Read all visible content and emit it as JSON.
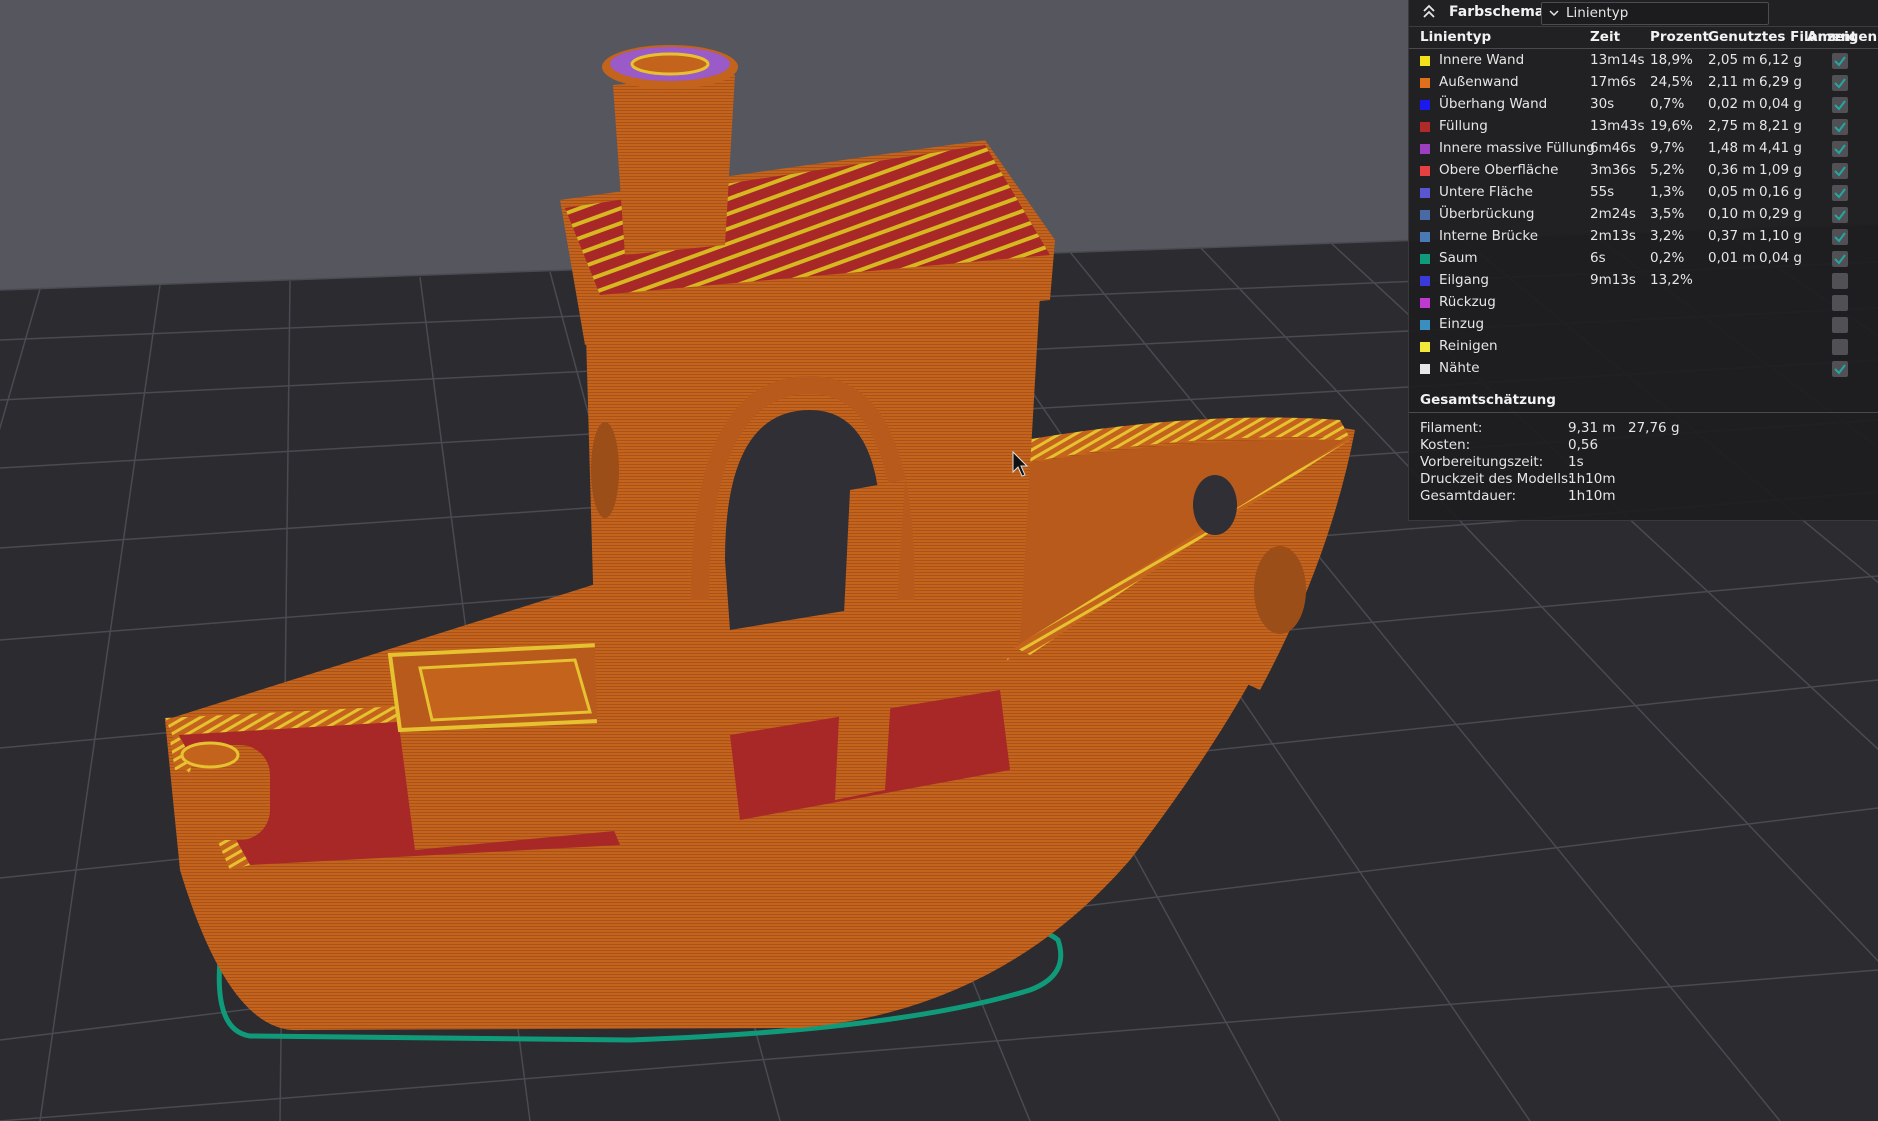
{
  "panel": {
    "title": "Farbschema",
    "scheme_value": "Linientyp",
    "columns": {
      "type": "Linientyp",
      "time": "Zeit",
      "percent": "Prozent",
      "used_filament": "Genutztes Filament",
      "show": "Anzeigen"
    },
    "rows": [
      {
        "name": "Innere Wand",
        "color": "#f2e21a",
        "time": "13m14s",
        "percent": "18,9%",
        "length": "2,05 m",
        "weight": "6,12 g",
        "shown": true
      },
      {
        "name": "Außenwand",
        "color": "#e0701c",
        "time": "17m6s",
        "percent": "24,5%",
        "length": "2,11 m",
        "weight": "6,29 g",
        "shown": true
      },
      {
        "name": "Überhang Wand",
        "color": "#1a1aee",
        "time": "30s",
        "percent": "0,7%",
        "length": "0,02 m",
        "weight": "0,04 g",
        "shown": true
      },
      {
        "name": "Füllung",
        "color": "#b02a2a",
        "time": "13m43s",
        "percent": "19,6%",
        "length": "2,75 m",
        "weight": "8,21 g",
        "shown": true
      },
      {
        "name": "Innere massive Füllung",
        "color": "#9a3fc0",
        "time": "6m46s",
        "percent": "9,7%",
        "length": "1,48 m",
        "weight": "4,41 g",
        "shown": true
      },
      {
        "name": "Obere Oberfläche",
        "color": "#e64040",
        "time": "3m36s",
        "percent": "5,2%",
        "length": "0,36 m",
        "weight": "1,09 g",
        "shown": true
      },
      {
        "name": "Untere Fläche",
        "color": "#5a56d0",
        "time": "55s",
        "percent": "1,3%",
        "length": "0,05 m",
        "weight": "0,16 g",
        "shown": true
      },
      {
        "name": "Überbrückung",
        "color": "#4a6aa6",
        "time": "2m24s",
        "percent": "3,5%",
        "length": "0,10 m",
        "weight": "0,29 g",
        "shown": true
      },
      {
        "name": "Interne Brücke",
        "color": "#4a7ab6",
        "time": "2m13s",
        "percent": "3,2%",
        "length": "0,37 m",
        "weight": "1,10 g",
        "shown": true
      },
      {
        "name": "Saum",
        "color": "#0f9b7a",
        "time": "6s",
        "percent": "0,2%",
        "length": "0,01 m",
        "weight": "0,04 g",
        "shown": true
      },
      {
        "name": "Eilgang",
        "color": "#3a3ad8",
        "time": "9m13s",
        "percent": "13,2%",
        "length": "",
        "weight": "",
        "shown": false
      },
      {
        "name": "Rückzug",
        "color": "#c03ad0",
        "time": "",
        "percent": "",
        "length": "",
        "weight": "",
        "shown": false
      },
      {
        "name": "Einzug",
        "color": "#3a8ec0",
        "time": "",
        "percent": "",
        "length": "",
        "weight": "",
        "shown": false
      },
      {
        "name": "Reinigen",
        "color": "#f2e83a",
        "time": "",
        "percent": "",
        "length": "",
        "weight": "",
        "shown": false
      },
      {
        "name": "Nähte",
        "color": "#e8e8e8",
        "time": "",
        "percent": "",
        "length": "",
        "weight": "",
        "shown": true
      }
    ],
    "totals_title": "Gesamtschätzung",
    "totals": [
      {
        "label": "Filament:",
        "value": "9,31 m",
        "value2": "27,76 g"
      },
      {
        "label": "Kosten:",
        "value": "0,56",
        "value2": ""
      },
      {
        "label": "Vorbereitungszeit:",
        "value": "1s",
        "value2": ""
      },
      {
        "label": "Druckzeit des Modells:",
        "value": "1h10m",
        "value2": ""
      },
      {
        "label": "Gesamtdauer:",
        "value": "1h10m",
        "value2": ""
      }
    ]
  },
  "colors": {
    "background_top": "#56565e",
    "plate": "#2b2b30",
    "grid": "#4a4a52",
    "hull": "#c4631c",
    "deck_fill": "#a82828",
    "infill_stripe": "#d8b820",
    "skirt": "#0f9b7a",
    "funnel_top": "#9a5ac8",
    "checkbox_check": "#22a8a0"
  },
  "icons": {
    "collapse": "chevron-up-double-icon",
    "dropdown": "chevron-down-icon",
    "cursor": "mouse-cursor-icon"
  }
}
